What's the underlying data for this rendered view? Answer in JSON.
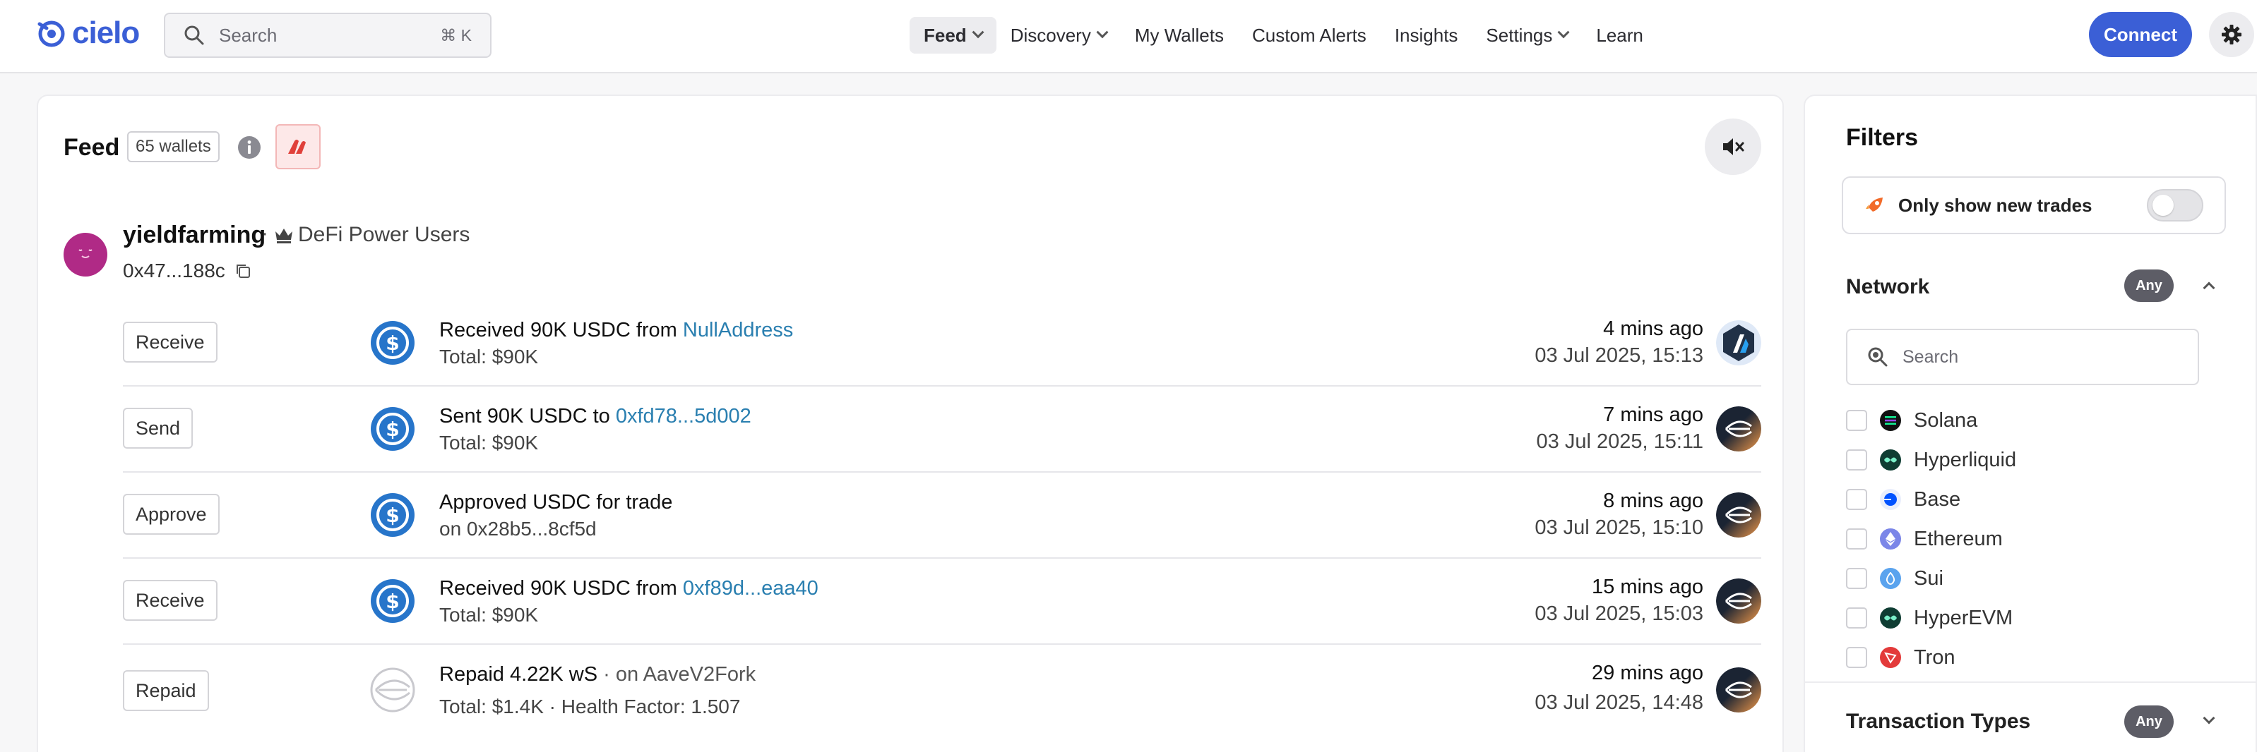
{
  "nav": {
    "logo": "cielo",
    "search_placeholder": "Search",
    "search_shortcut": "⌘ K",
    "items": [
      {
        "label": "Feed",
        "dropdown": true,
        "active": true
      },
      {
        "label": "Discovery",
        "dropdown": true,
        "active": false
      },
      {
        "label": "My Wallets",
        "dropdown": false,
        "active": false
      },
      {
        "label": "Custom Alerts",
        "dropdown": false,
        "active": false
      },
      {
        "label": "Insights",
        "dropdown": false,
        "active": false
      },
      {
        "label": "Settings",
        "dropdown": true,
        "active": false
      },
      {
        "label": "Learn",
        "dropdown": false,
        "active": false
      }
    ],
    "connect_label": "Connect"
  },
  "feed": {
    "title": "Feed",
    "wallet_count": "65 wallets",
    "wallet": {
      "name": "yieldfarming",
      "separator": "·",
      "group": "DeFi Power Users",
      "address": "0x47...188c"
    },
    "transactions": [
      {
        "type": "Receive",
        "line1_text": "Received 90K USDC from ",
        "line1_link": "NullAddress",
        "line2": "Total: $90K",
        "ago": "4 mins ago",
        "date": "03 Jul 2025, 15:13",
        "token_icon": "usdc-icon",
        "chain_icon": "arbitrum-icon"
      },
      {
        "type": "Send",
        "line1_text": "Sent 90K USDC to ",
        "line1_link": "0xfd78...5d002",
        "line2": "Total: $90K",
        "ago": "7 mins ago",
        "date": "03 Jul 2025, 15:11",
        "token_icon": "usdc-icon",
        "chain_icon": "sonic-icon"
      },
      {
        "type": "Approve",
        "line1_text": "Approved USDC for trade",
        "line1_link": "",
        "line2": "on 0x28b5...8cf5d",
        "ago": "8 mins ago",
        "date": "03 Jul 2025, 15:10",
        "token_icon": "usdc-icon",
        "chain_icon": "sonic-icon"
      },
      {
        "type": "Receive",
        "line1_text": "Received 90K USDC from ",
        "line1_link": "0xf89d...eaa40",
        "line2": "Total: $90K",
        "ago": "15 mins ago",
        "date": "03 Jul 2025, 15:03",
        "token_icon": "usdc-icon",
        "chain_icon": "sonic-icon"
      },
      {
        "type": "Repaid",
        "line1_text": "Repaid 4.22K wS",
        "line1_suffix": " · on AaveV2Fork",
        "line1_link": "",
        "line2": "Total: $1.4K · Health Factor: 1.507",
        "ago": "29 mins ago",
        "date": "03 Jul 2025, 14:48",
        "token_icon": "ws-icon",
        "chain_icon": "sonic-icon"
      }
    ]
  },
  "filters": {
    "title": "Filters",
    "new_trades_label": "Only show new trades",
    "new_trades_enabled": false,
    "network": {
      "title": "Network",
      "badge": "Any",
      "search_placeholder": "Search",
      "items": [
        {
          "label": "Solana",
          "color": "#111111"
        },
        {
          "label": "Hyperliquid",
          "color": "#0f3d33"
        },
        {
          "label": "Base",
          "color": "#e9eefc"
        },
        {
          "label": "Ethereum",
          "color": "#7b86e8"
        },
        {
          "label": "Sui",
          "color": "#5aa3ee"
        },
        {
          "label": "HyperEVM",
          "color": "#0f3d33"
        },
        {
          "label": "Tron",
          "color": "#e33a3a"
        }
      ]
    },
    "transaction_types": {
      "title": "Transaction Types",
      "badge": "Any"
    }
  },
  "colors": {
    "brand": "#3b5fd6",
    "link": "#2a7fb0",
    "usdc": "#2775ca"
  }
}
